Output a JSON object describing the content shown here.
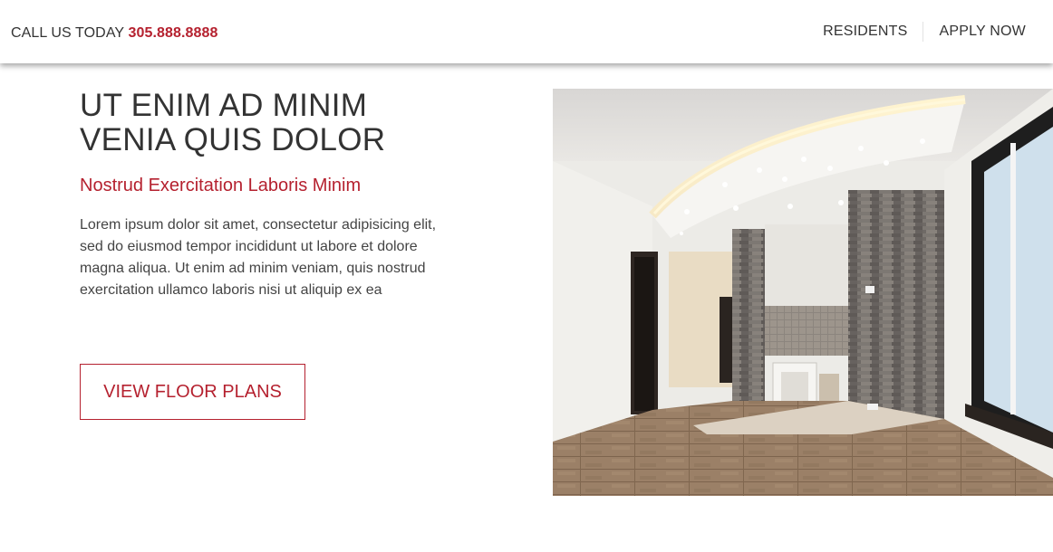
{
  "header": {
    "call_label": "CALL US TODAY",
    "phone": "305.888.8888",
    "nav": {
      "residents": "RESIDENTS",
      "apply": "APPLY NOW"
    }
  },
  "main": {
    "headline_line1": "UT ENIM AD MINIM",
    "headline_line2": "VENIA QUIS DOLOR",
    "subheading": "Nostrud Exercitation Laboris Minim",
    "body": "Lorem ipsum dolor sit amet, consectetur adipisicing elit, sed do eiusmod tempor incididunt ut labore et dolore magna aliqua. Ut enim ad minim veniam, quis nostrud exercitation ullamco laboris nisi ut aliquip ex ea",
    "cta": "VIEW FLOOR PLANS"
  },
  "colors": {
    "accent": "#b5212f",
    "text": "#333333",
    "background": "#ffffff"
  }
}
